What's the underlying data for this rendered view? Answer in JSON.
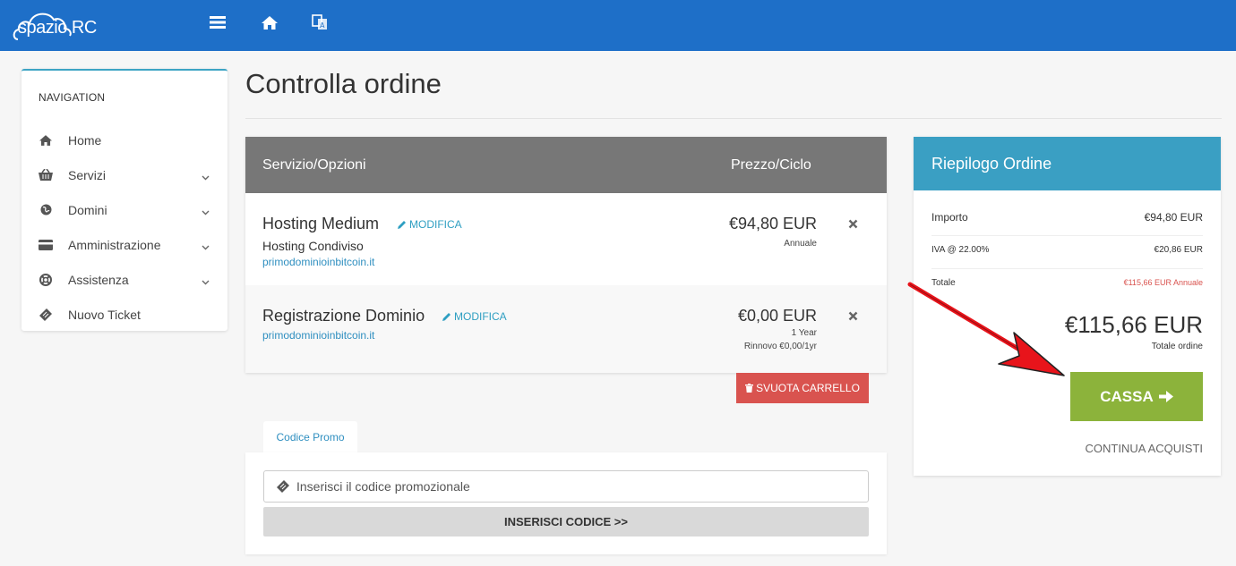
{
  "brand": {
    "logo_text": "spazio RC"
  },
  "topbar": {
    "menu_icon": "hamburger-icon",
    "home_icon": "home-icon",
    "translate_icon": "translate-icon"
  },
  "sidebar": {
    "title": "NAVIGATION",
    "items": [
      {
        "label": "Home",
        "icon": "home-icon",
        "has_submenu": false
      },
      {
        "label": "Servizi",
        "icon": "basket-icon",
        "has_submenu": true
      },
      {
        "label": "Domini",
        "icon": "globe-icon",
        "has_submenu": true
      },
      {
        "label": "Amministrazione",
        "icon": "credit-card-icon",
        "has_submenu": true
      },
      {
        "label": "Assistenza",
        "icon": "lifebuoy-icon",
        "has_submenu": true
      },
      {
        "label": "Nuovo Ticket",
        "icon": "ticket-icon",
        "has_submenu": false
      }
    ]
  },
  "page": {
    "title": "Controlla ordine"
  },
  "cart": {
    "col_service": "Servizio/Opzioni",
    "col_price": "Prezzo/Ciclo",
    "edit_label": "MODIFICA",
    "items": [
      {
        "name": "Hosting Medium",
        "subtitle": "Hosting Condiviso",
        "domain": "primodominioinbitcoin.it",
        "price": "€94,80 EUR",
        "cycle": "Annuale",
        "renewal": ""
      },
      {
        "name": "Registrazione Dominio",
        "subtitle": "",
        "domain": "primodominioinbitcoin.it",
        "price": "€0,00 EUR",
        "cycle": "1 Year",
        "renewal": "Rinnovo €0,00/1yr"
      }
    ],
    "empty_button": "SVUOTA CARRELLO"
  },
  "promo": {
    "tab_label": "Codice Promo",
    "placeholder": "Inserisci il codice promozionale",
    "button": "INSERISCI CODICE >>"
  },
  "summary": {
    "title": "Riepilogo Ordine",
    "rows": [
      {
        "label": "Importo",
        "value": "€94,80 EUR"
      },
      {
        "label": "IVA @ 22.00%",
        "value": "€20,86 EUR"
      },
      {
        "label": "Totale",
        "value": "€115,66 EUR Annuale"
      }
    ],
    "grand_total": "€115,66 EUR",
    "grand_total_label": "Totale ordine",
    "checkout_button": "CASSA",
    "continue_link": "CONTINUA ACQUISTI"
  },
  "colors": {
    "topbar": "#1e6fc8",
    "summary_header": "#3a9fc3",
    "checkout": "#8cb33b",
    "empty_cart": "#d9534f",
    "annotation_arrow": "#e8141b"
  }
}
